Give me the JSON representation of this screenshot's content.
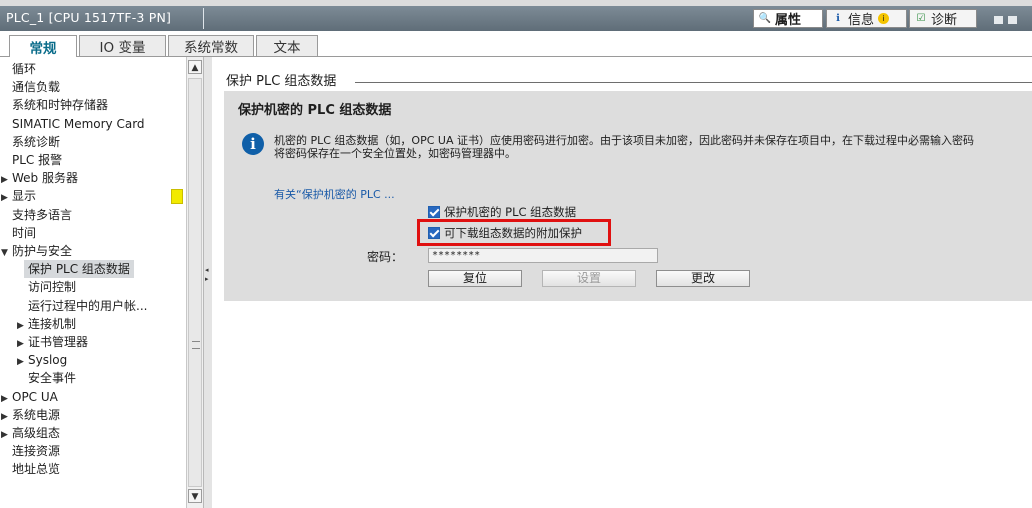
{
  "window": {
    "title": "PLC_1 [CPU 1517TF-3 PN]",
    "tabs": [
      {
        "icon": "properties-icon",
        "label": "属性"
      },
      {
        "icon": "info-icon",
        "label": "信息"
      },
      {
        "icon": "diagnostics-icon",
        "label": "诊断"
      }
    ]
  },
  "subtabs": [
    "常规",
    "IO 变量",
    "系统常数",
    "文本"
  ],
  "nav": {
    "items": [
      {
        "label": "循环",
        "indent": 0,
        "arrow": ""
      },
      {
        "label": "通信负载",
        "indent": 0,
        "arrow": ""
      },
      {
        "label": "系统和时钟存储器",
        "indent": 0,
        "arrow": ""
      },
      {
        "label": "SIMATIC Memory Card",
        "indent": 0,
        "arrow": ""
      },
      {
        "label": "系统诊断",
        "indent": 0,
        "arrow": ""
      },
      {
        "label": "PLC 报警",
        "indent": 0,
        "arrow": ""
      },
      {
        "label": "Web 服务器",
        "indent": 0,
        "arrow": "▶"
      },
      {
        "label": "显示",
        "indent": 0,
        "arrow": "▶"
      },
      {
        "label": "支持多语言",
        "indent": 0,
        "arrow": ""
      },
      {
        "label": "时间",
        "indent": 0,
        "arrow": ""
      },
      {
        "label": "防护与安全",
        "indent": 0,
        "arrow": "▼"
      },
      {
        "label": "保护 PLC 组态数据",
        "indent": 1,
        "arrow": "",
        "selected": true
      },
      {
        "label": "访问控制",
        "indent": 1,
        "arrow": ""
      },
      {
        "label": "运行过程中的用户帐...",
        "indent": 1,
        "arrow": ""
      },
      {
        "label": "连接机制",
        "indent": 1,
        "arrow": "▶"
      },
      {
        "label": "证书管理器",
        "indent": 1,
        "arrow": "▶"
      },
      {
        "label": "Syslog",
        "indent": 1,
        "arrow": "▶"
      },
      {
        "label": "安全事件",
        "indent": 1,
        "arrow": ""
      },
      {
        "label": "OPC UA",
        "indent": 0,
        "arrow": "▶"
      },
      {
        "label": "系统电源",
        "indent": 0,
        "arrow": "▶"
      },
      {
        "label": "高级组态",
        "indent": 0,
        "arrow": "▶"
      },
      {
        "label": "连接资源",
        "indent": 0,
        "arrow": ""
      },
      {
        "label": "地址总览",
        "indent": 0,
        "arrow": ""
      }
    ]
  },
  "main": {
    "section_title": "保护 PLC 组态数据",
    "panel_heading": "保护机密的 PLC 组态数据",
    "info_line1": "机密的 PLC 组态数据（如，OPC UA 证书）应使用密码进行加密。由于该项目未加密，因此密码并未保存在项目中，在下载过程中必需输入密码",
    "info_line2": "将密码保存在一个安全位置处，如密码管理器中。",
    "more_link": "有关“保护机密的 PLC ...",
    "checkbox1": "保护机密的 PLC 组态数据",
    "checkbox2": "可下载组态数据的附加保护",
    "password_label": "密码：",
    "password_value": "********",
    "btn_reset": "复位",
    "btn_set": "设置",
    "btn_change": "更改"
  },
  "colors": {
    "title_bar": "#6f7d88",
    "active_subtab_text": "#0a6c8a",
    "panel_bg": "#dddddd",
    "highlight": "#e01010",
    "link": "#1a5aa8"
  }
}
